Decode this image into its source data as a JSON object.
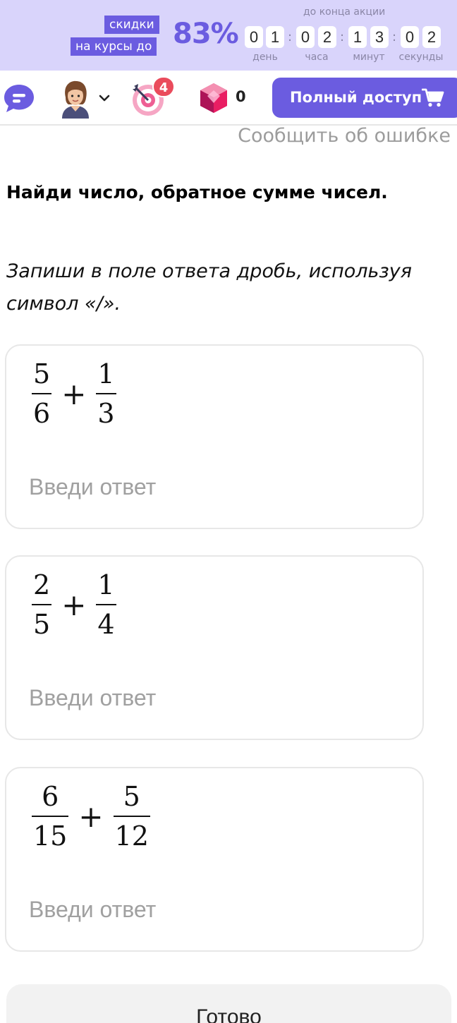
{
  "promo": {
    "tag_line1": "скидки",
    "tag_line2": "на курсы до",
    "percent": "83%",
    "timer_title": "до конца акции",
    "timer_digits": [
      "0",
      "1",
      "0",
      "2",
      "1",
      "3",
      "0",
      "2"
    ],
    "timer_units": [
      "день",
      "часа",
      "минут",
      "секунды"
    ],
    "accent_color": "#6b5ce0",
    "background_color": "#d9d4fb"
  },
  "toolbar": {
    "chat_icon": "chat-bubble-icon",
    "avatar_icon": "user-avatar",
    "goal_icon": "target-dart-icon",
    "goal_badge": "4",
    "gem_icon": "crystal-gem-icon",
    "gem_count": "0",
    "full_access_label": "Полный доступ",
    "cart_icon": "shopping-cart-icon"
  },
  "report_link": "Сообщить об ошибке",
  "task": {
    "title": "Найди число, обратное сумме чисел.",
    "instruction": "Запиши в поле ответа дробь, используя символ «/»."
  },
  "exercises": [
    {
      "a_num": "5",
      "a_den": "6",
      "operator": "+",
      "b_num": "1",
      "b_den": "3",
      "placeholder": "Введи ответ",
      "value": ""
    },
    {
      "a_num": "2",
      "a_den": "5",
      "operator": "+",
      "b_num": "1",
      "b_den": "4",
      "placeholder": "Введи ответ",
      "value": ""
    },
    {
      "a_num": "6",
      "a_den": "15",
      "operator": "+",
      "b_num": "5",
      "b_den": "12",
      "placeholder": "Введи ответ",
      "value": ""
    }
  ],
  "done_label": "Готово"
}
